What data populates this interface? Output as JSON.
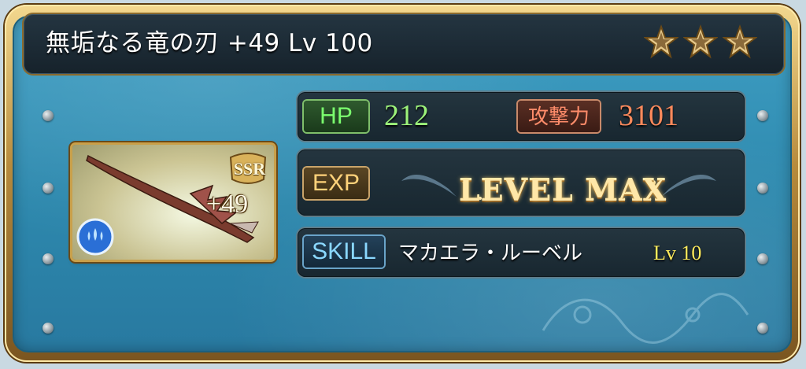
{
  "item": {
    "title": "無垢なる竜の刃 +49 Lv 100",
    "rarity_badge": "SSR",
    "plus_label": "+49",
    "stars_filled": 3
  },
  "stats": {
    "hp_label": "HP",
    "hp_value": "212",
    "atk_label": "攻撃力",
    "atk_value": "3101",
    "exp_label": "EXP",
    "exp_status": "LEVEL MAX"
  },
  "skill": {
    "label": "SKILL",
    "name": "マカエラ・ルーベル",
    "level": "Lv 10"
  },
  "colors": {
    "panel": "#2d88ad",
    "hp": "#9cf27a",
    "atk": "#ff8a5c",
    "skill_level": "#ffec5c",
    "gold_frame": "#c9a04a"
  },
  "icons": {
    "element": "water-element-icon",
    "star": "star-icon"
  }
}
